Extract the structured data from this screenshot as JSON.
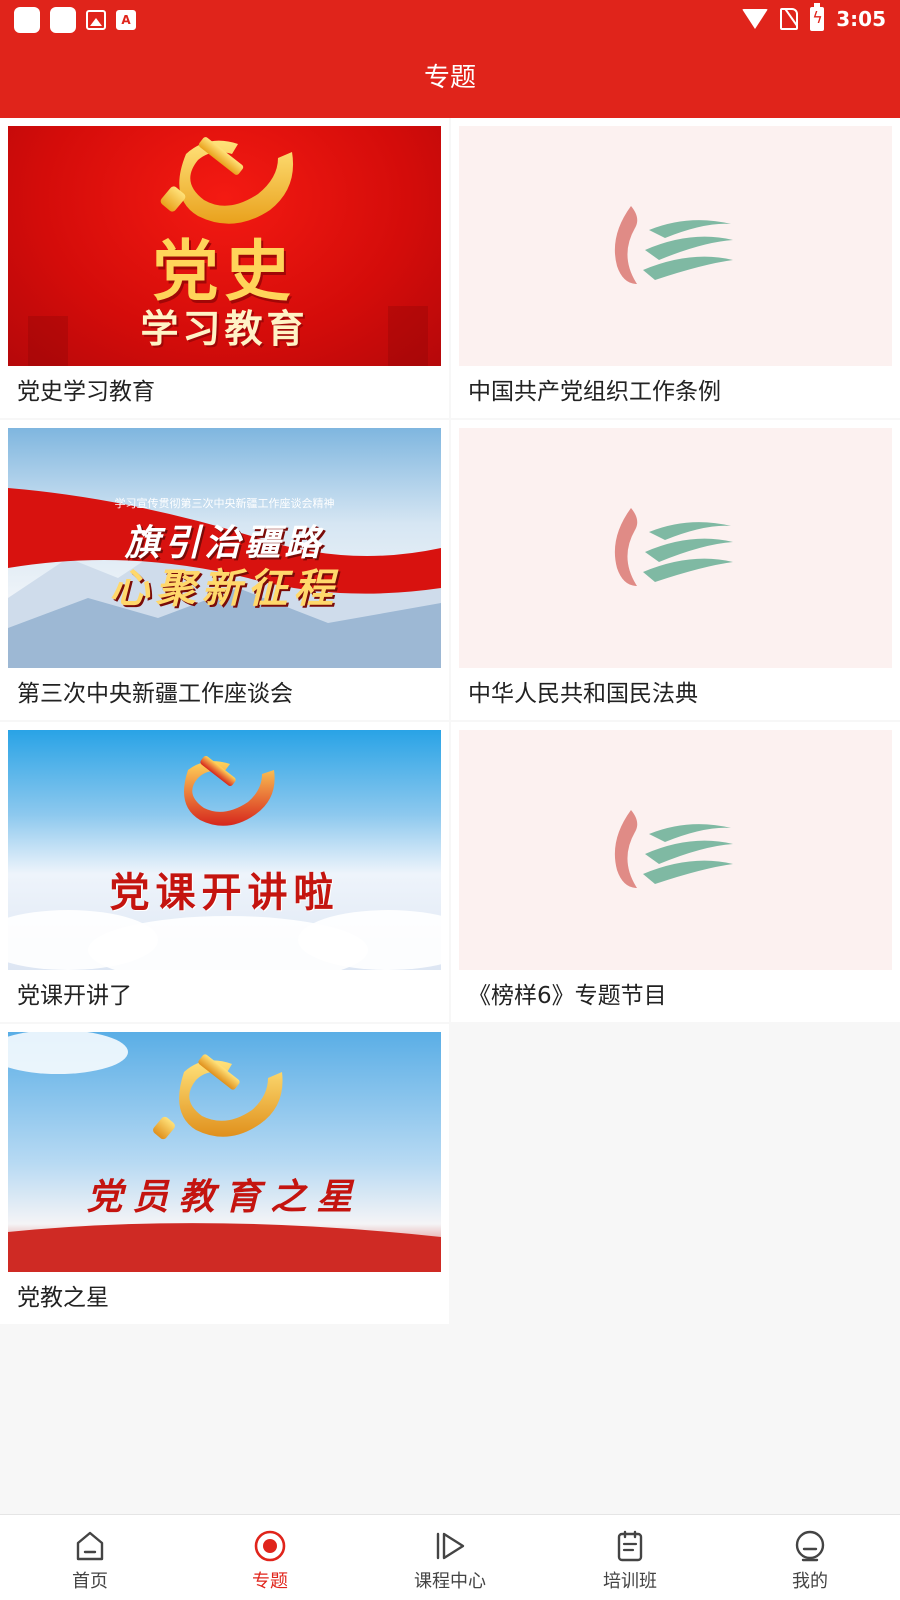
{
  "status_bar": {
    "time": "3:05"
  },
  "header": {
    "title": "专题"
  },
  "topics": [
    {
      "title": "党史学习教育",
      "poster": {
        "line1": "党史",
        "line2": "学习教育"
      }
    },
    {
      "title": "中国共产党组织工作条例"
    },
    {
      "title": "第三次中央新疆工作座谈会",
      "poster": {
        "small": "学习宣传贯彻第三次中央新疆工作座谈会精神",
        "line1": "旗引治疆路",
        "line2": "心聚新征程"
      }
    },
    {
      "title": "中华人民共和国民法典"
    },
    {
      "title": "党课开讲了",
      "poster": {
        "line1": "党课开讲啦"
      }
    },
    {
      "title": "《榜样6》专题节目"
    },
    {
      "title": "党教之星",
      "poster": {
        "line1": "党员教育之星"
      }
    }
  ],
  "tabbar": {
    "items": [
      {
        "label": "首页",
        "icon": "home-icon",
        "active": false
      },
      {
        "label": "专题",
        "icon": "record-icon",
        "active": true
      },
      {
        "label": "课程中心",
        "icon": "play-icon",
        "active": false
      },
      {
        "label": "培训班",
        "icon": "notebook-icon",
        "active": false
      },
      {
        "label": "我的",
        "icon": "profile-icon",
        "active": false
      }
    ]
  },
  "colors": {
    "primary": "#e0241b",
    "gold": "#f5c542",
    "logo_red": "#d9534f",
    "logo_green": "#5aa58a"
  }
}
